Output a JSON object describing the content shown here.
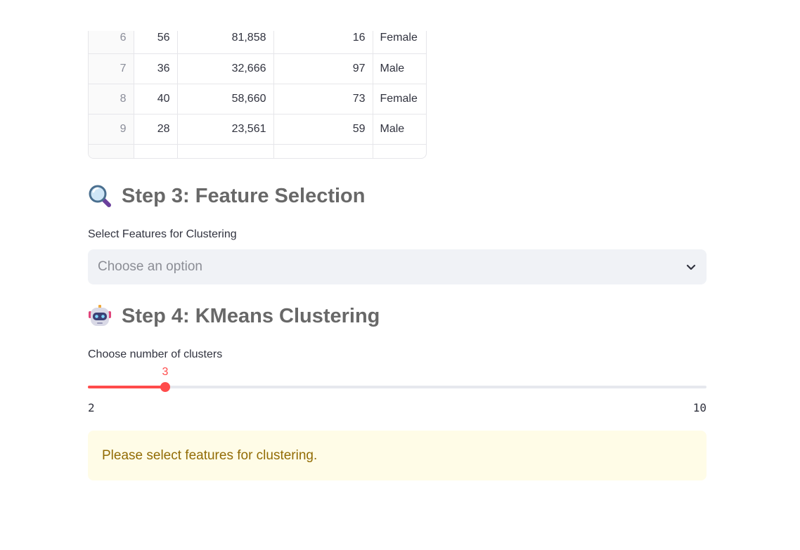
{
  "table": {
    "rows": [
      {
        "index": "6",
        "c1": "56",
        "c2": "81,858",
        "c3": "16",
        "c4": "Female"
      },
      {
        "index": "7",
        "c1": "36",
        "c2": "32,666",
        "c3": "97",
        "c4": "Male"
      },
      {
        "index": "8",
        "c1": "40",
        "c2": "58,660",
        "c3": "73",
        "c4": "Female"
      },
      {
        "index": "9",
        "c1": "28",
        "c2": "23,561",
        "c3": "59",
        "c4": "Male"
      }
    ]
  },
  "step3": {
    "heading": "Step 3: Feature Selection",
    "icon": "magnifying-glass-icon",
    "select_label": "Select Features for Clustering",
    "select_placeholder": "Choose an option"
  },
  "step4": {
    "heading": "Step 4: KMeans Clustering",
    "icon": "robot-icon",
    "slider_label": "Choose number of clusters",
    "slider_value": "3",
    "slider_min": "2",
    "slider_max": "10"
  },
  "alert": {
    "message": "Please select features for clustering."
  },
  "colors": {
    "accent": "#ff4b4b",
    "warning_bg": "#fffce7",
    "warning_text": "#926c05"
  }
}
